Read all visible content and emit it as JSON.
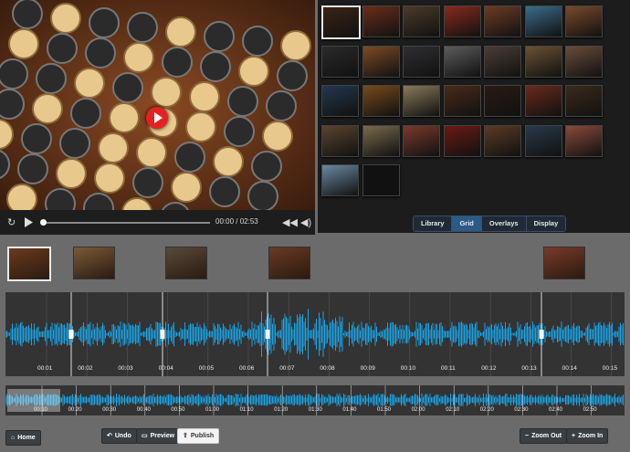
{
  "player": {
    "current_time": "00:00",
    "separator": "/",
    "duration": "02:53"
  },
  "tabs": [
    "Library",
    "Grid",
    "Overlays",
    "Display"
  ],
  "active_tab": "Grid",
  "grid": {
    "thumbnail_count": 30,
    "columns": 7,
    "selected_index": 0,
    "colors": [
      "#3a2414",
      "#6b2d1a",
      "#4b3a2a",
      "#8a2a1d",
      "#6e3b24",
      "#3b6c8d",
      "#7a4a2b",
      "#2a2a2a",
      "#7e4a24",
      "#2f2f32",
      "#5c5c5c",
      "#4d3c35",
      "#6a5233",
      "#6a4c3c",
      "#22384d",
      "#7a4a1a",
      "#8a7a5a",
      "#4a2a1a",
      "#2a1a14",
      "#6a2a1a",
      "#3a2a1c",
      "#5a4430",
      "#7a6a4c",
      "#7a3a2a",
      "#6a1a14",
      "#5c3a24",
      "#2a3a4a",
      "#8a4a3a",
      "#6a8aa0",
      "#111111"
    ]
  },
  "timeline": {
    "ticks": [
      "00:01",
      "00:02",
      "00:03",
      "00:04",
      "00:05",
      "00:06",
      "00:07",
      "00:08",
      "00:09",
      "00:10",
      "00:11",
      "00:12",
      "00:13",
      "00:14",
      "00:15"
    ],
    "mini_ticks": [
      "00:10",
      "00:20",
      "00:30",
      "00:40",
      "00:50",
      "01:00",
      "01:10",
      "01:20",
      "01:30",
      "01:40",
      "01:50",
      "02:00",
      "02:10",
      "02:20",
      "02:30",
      "02:40",
      "02:50"
    ],
    "clip_colors": [
      "#6a3a1e",
      "#7a5a3a",
      "#5a4a3a",
      "#6a3a24",
      "#7a3a2a"
    ],
    "accent": "#18a3e6"
  },
  "buttons": {
    "home": "Home",
    "undo": "Undo",
    "preview": "Preview",
    "publish": "Publish",
    "zoom_out": "Zoom Out",
    "zoom_in": "Zoom In"
  }
}
